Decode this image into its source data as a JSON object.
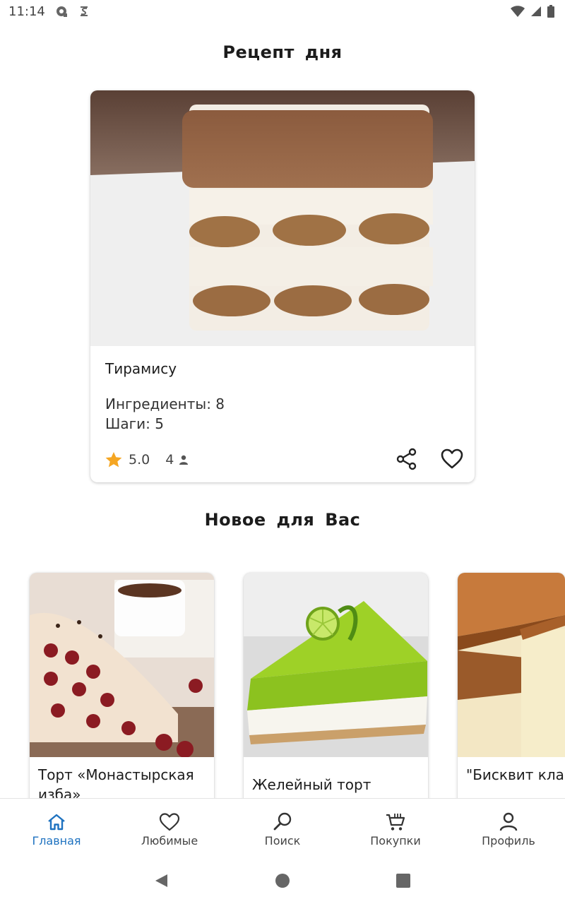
{
  "status_bar": {
    "time": "11:14"
  },
  "sections": {
    "recipe_of_day_title": "Рецепт дня",
    "new_for_you_title": "Новое для Вас"
  },
  "recipe_of_day": {
    "name": "Тирамису",
    "ingredients": "Ингредиенты: 8",
    "steps": "Шаги: 5",
    "rating": "5.0",
    "servings": "4",
    "image_icon": "tiramisu-photo",
    "icons": {
      "rating": "star-icon",
      "servings": "person-icon",
      "share": "share-icon",
      "favorite": "heart-icon"
    },
    "accent_star_color": "#f5a623"
  },
  "new_recipes": [
    {
      "title": "Торт «Монастырская изба»",
      "image_icon": "cherry-cake-photo"
    },
    {
      "title": "Желейный торт",
      "image_icon": "lime-jelly-cake-photo"
    },
    {
      "title": "\"Бисквит классически",
      "image_icon": "sponge-cake-photo"
    }
  ],
  "bottom_nav": {
    "active_color": "#1e72c0",
    "items": [
      {
        "label": "Главная",
        "icon": "home-icon",
        "active": true
      },
      {
        "label": "Любимые",
        "icon": "heart-icon",
        "active": false
      },
      {
        "label": "Поиск",
        "icon": "search-icon",
        "active": false
      },
      {
        "label": "Покупки",
        "icon": "cart-icon",
        "active": false
      },
      {
        "label": "Профиль",
        "icon": "profile-icon",
        "active": false
      }
    ]
  }
}
